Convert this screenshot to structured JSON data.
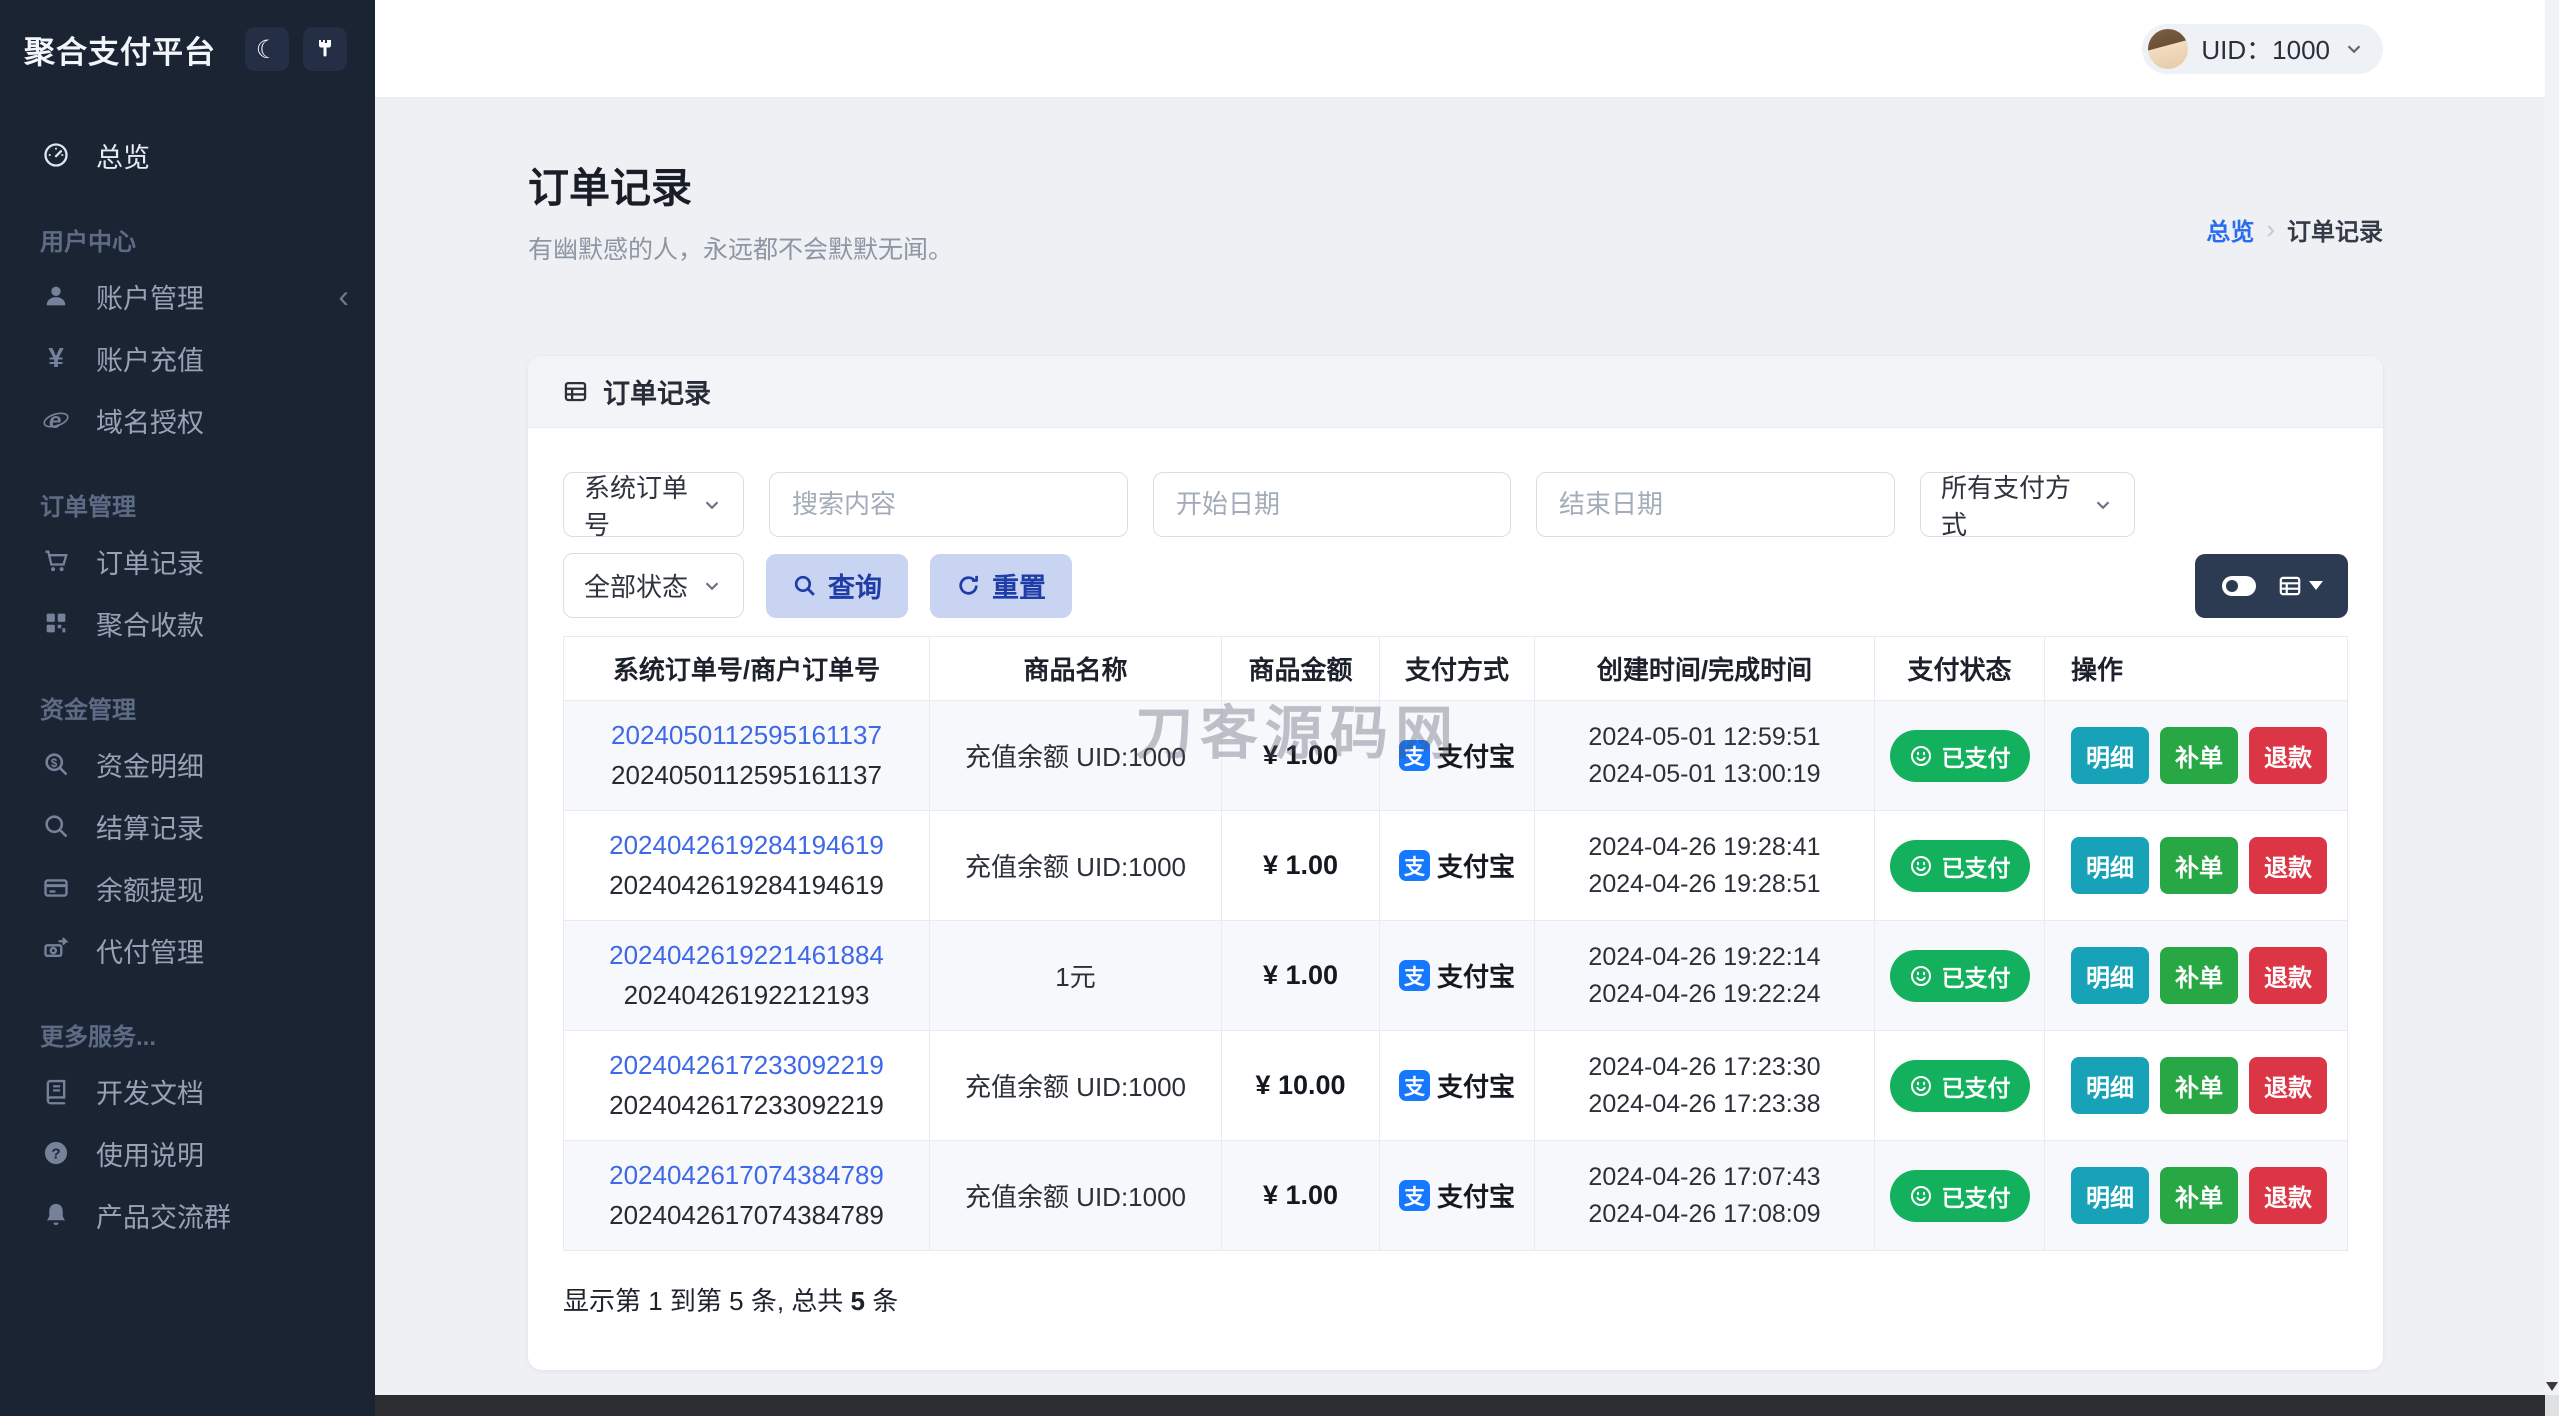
{
  "app": {
    "title": "聚合支付平台"
  },
  "topbar": {
    "uid": "UID：1000"
  },
  "sidebar": {
    "overview": "总览",
    "sections": [
      {
        "label": "用户中心",
        "items": [
          "账户管理",
          "账户充值",
          "域名授权"
        ]
      },
      {
        "label": "订单管理",
        "items": [
          "订单记录",
          "聚合收款"
        ]
      },
      {
        "label": "资金管理",
        "items": [
          "资金明细",
          "结算记录",
          "余额提现",
          "代付管理"
        ]
      },
      {
        "label": "更多服务...",
        "items": [
          "开发文档",
          "使用说明",
          "产品交流群"
        ]
      }
    ],
    "icons": [
      "dashboard-icon",
      "user-icon",
      "yen-icon",
      "globe-icon",
      "cart-icon",
      "qrcode-icon",
      "search-dollar-icon",
      "search-icon",
      "credit-card-icon",
      "money-transfer-icon",
      "book-icon",
      "question-icon",
      "bell-icon"
    ]
  },
  "page": {
    "title": "订单记录",
    "subtitle": "有幽默感的人，永远都不会默默无闻。",
    "breadcrumb": {
      "root": "总览",
      "separator": "›",
      "current": "订单记录"
    }
  },
  "card": {
    "header": "订单记录"
  },
  "filters": {
    "order_type_select": "系统订单号",
    "search_placeholder": "搜索内容",
    "start_date_placeholder": "开始日期",
    "end_date_placeholder": "结束日期",
    "pay_method_select": "所有支付方式",
    "status_select": "全部状态",
    "query_button": "查询",
    "reset_button": "重置"
  },
  "table": {
    "columns": [
      "系统订单号/商户订单号",
      "商品名称",
      "商品金额",
      "支付方式",
      "创建时间/完成时间",
      "支付状态",
      "操作"
    ],
    "alipay_glyph": "支",
    "rows": [
      {
        "sys_no": "2024050112595161137",
        "mch_no": "2024050112595161137",
        "product": "充值余额 UID:1000",
        "amount": "¥ 1.00",
        "method": "支付宝",
        "created": "2024-05-01 12:59:51",
        "completed": "2024-05-01 13:00:19",
        "status": "已支付",
        "actions": [
          "明细",
          "补单",
          "退款"
        ]
      },
      {
        "sys_no": "2024042619284194619",
        "mch_no": "2024042619284194619",
        "product": "充值余额 UID:1000",
        "amount": "¥ 1.00",
        "method": "支付宝",
        "created": "2024-04-26 19:28:41",
        "completed": "2024-04-26 19:28:51",
        "status": "已支付",
        "actions": [
          "明细",
          "补单",
          "退款"
        ]
      },
      {
        "sys_no": "2024042619221461884",
        "mch_no": "20240426192212193",
        "product": "1元",
        "amount": "¥ 1.00",
        "method": "支付宝",
        "created": "2024-04-26 19:22:14",
        "completed": "2024-04-26 19:22:24",
        "status": "已支付",
        "actions": [
          "明细",
          "补单",
          "退款"
        ]
      },
      {
        "sys_no": "2024042617233092219",
        "mch_no": "2024042617233092219",
        "product": "充值余额 UID:1000",
        "amount": "¥ 10.00",
        "method": "支付宝",
        "created": "2024-04-26 17:23:30",
        "completed": "2024-04-26 17:23:38",
        "status": "已支付",
        "actions": [
          "明细",
          "补单",
          "退款"
        ]
      },
      {
        "sys_no": "2024042617074384789",
        "mch_no": "2024042617074384789",
        "product": "充值余额 UID:1000",
        "amount": "¥ 1.00",
        "method": "支付宝",
        "created": "2024-04-26 17:07:43",
        "completed": "2024-04-26 17:08:09",
        "status": "已支付",
        "actions": [
          "明细",
          "补单",
          "退款"
        ]
      }
    ],
    "summary_prefix": "显示第 1 到第 5 条, 总共 ",
    "summary_count": "5",
    "summary_suffix": " 条"
  },
  "watermark": "刀客源码网",
  "colors": {
    "sidebar_bg": "#1b2433",
    "accent_link": "#3e68e7",
    "breadcrumb_blue": "#2a6cf0",
    "success_badge": "#13b15d",
    "action_detail": "#17a2b8",
    "action_reissue": "#28a745",
    "action_refund": "#dc3545",
    "alipay_blue": "#1677ff",
    "soft_button_bg": "#c9d3f2"
  }
}
